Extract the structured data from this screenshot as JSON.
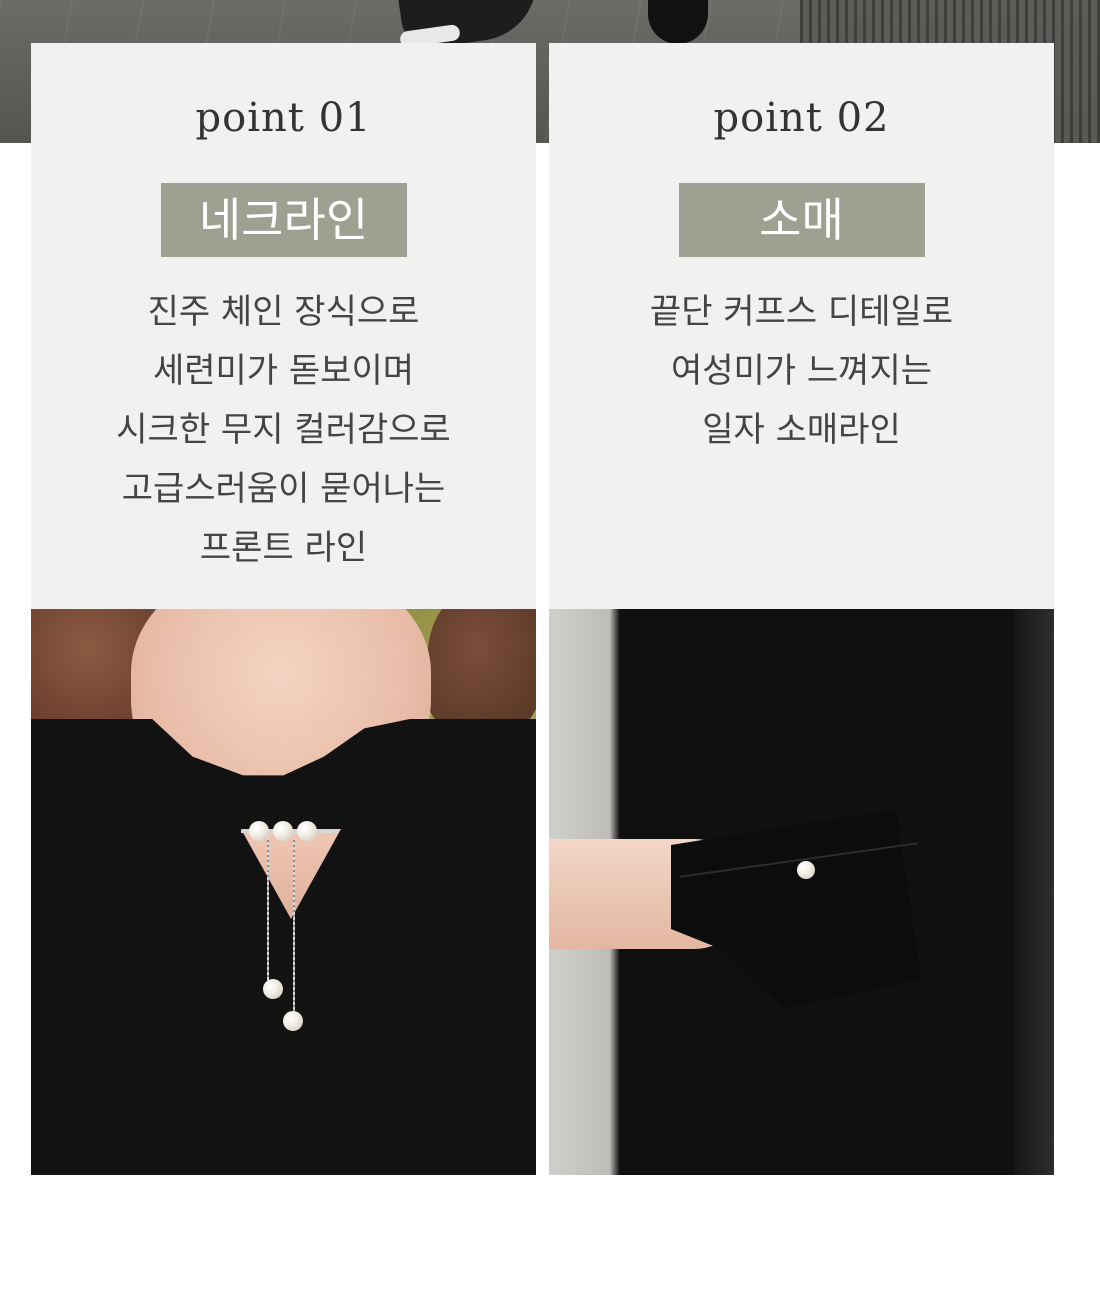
{
  "points": [
    {
      "title": "point 01",
      "tag": "네크라인",
      "description": [
        "진주 체인 장식으로",
        "세련미가 돋보이며",
        "시크한 무지 컬러감으로",
        "고급스러움이 묻어나는",
        "프론트 라인"
      ],
      "photo": "neckline-closeup"
    },
    {
      "title": "point 02",
      "tag": "소매",
      "description": [
        "끝단 커프스 디테일로",
        "여성미가 느껴지는",
        "일자 소매라인"
      ],
      "photo": "sleeve-cuff-closeup"
    }
  ],
  "colors": {
    "panel_bg": "#f1f1f1",
    "tag_bg": "#9ea092",
    "tag_text": "#ffffff",
    "title_text": "#333333",
    "desc_text": "#444444"
  }
}
